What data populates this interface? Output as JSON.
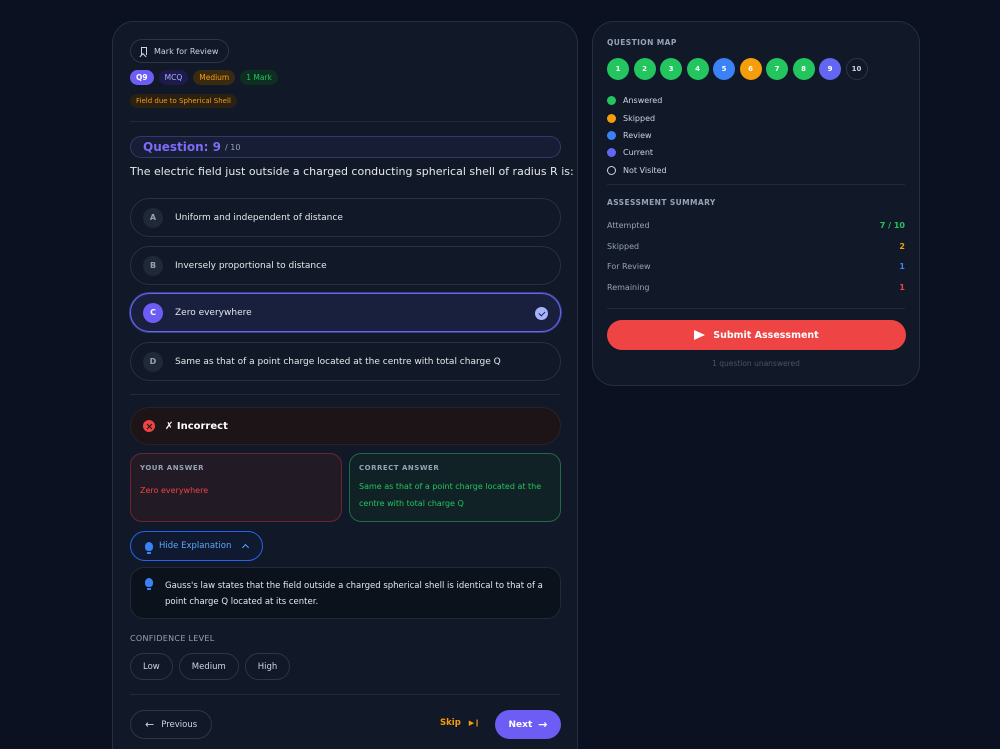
{
  "question": {
    "mark_review_label": "Mark for Review",
    "tags": {
      "id": "Q9",
      "type": "MCQ",
      "difficulty": "Medium",
      "marks": "1 Mark"
    },
    "topic": "Field due to Spherical Shell",
    "heading_label": "Question: 9",
    "heading_total": "/ 10",
    "text": "The electric field just outside a charged conducting spherical shell of radius R is:",
    "options": [
      {
        "letter": "A",
        "text": "Uniform and independent of distance"
      },
      {
        "letter": "B",
        "text": "Inversely proportional to distance"
      },
      {
        "letter": "C",
        "text": "Zero everywhere"
      },
      {
        "letter": "D",
        "text": "Same as that of a point charge located at the centre with total charge Q"
      }
    ],
    "selected": "C"
  },
  "result": {
    "status": "✗ Incorrect",
    "your_answer_label": "YOUR ANSWER",
    "your_answer": "Zero everywhere",
    "correct_answer_label": "CORRECT ANSWER",
    "correct_answer": "Same as that of a point charge located at the centre with total charge Q",
    "hide_explanation_label": "Hide Explanation",
    "explanation": "Gauss's law states that the field outside a charged spherical shell is identical to that of a point charge Q located at its center."
  },
  "confidence": {
    "label": "CONFIDENCE LEVEL",
    "levels": [
      "Low",
      "Medium",
      "High"
    ]
  },
  "navigation": {
    "previous": "Previous",
    "skip": "Skip",
    "next": "Next"
  },
  "question_map": {
    "title": "QUESTION MAP",
    "items": [
      {
        "n": "1",
        "state": "ans"
      },
      {
        "n": "2",
        "state": "ans"
      },
      {
        "n": "3",
        "state": "ans"
      },
      {
        "n": "4",
        "state": "ans"
      },
      {
        "n": "5",
        "state": "rev"
      },
      {
        "n": "6",
        "state": "skp"
      },
      {
        "n": "7",
        "state": "ans"
      },
      {
        "n": "8",
        "state": "ans"
      },
      {
        "n": "9",
        "state": "cur"
      },
      {
        "n": "10",
        "state": "nv"
      }
    ],
    "legend": [
      "Answered",
      "Skipped",
      "Review",
      "Current",
      "Not Visited"
    ]
  },
  "summary": {
    "title": "ASSESSMENT SUMMARY",
    "attempted_label": "Attempted",
    "attempted": "7 / 10",
    "skipped_label": "Skipped",
    "skipped": "2",
    "review_label": "For Review",
    "review": "1",
    "remaining_label": "Remaining",
    "remaining": "1",
    "submit_label": "Submit Assessment",
    "unanswered_note": "1 question unanswered"
  },
  "colors": {
    "answered": "#22c55e",
    "skipped": "#f59e0b",
    "review": "#3b82f6",
    "current": "#6366f1",
    "danger": "#ef4444",
    "accent": "#6d5df5"
  }
}
